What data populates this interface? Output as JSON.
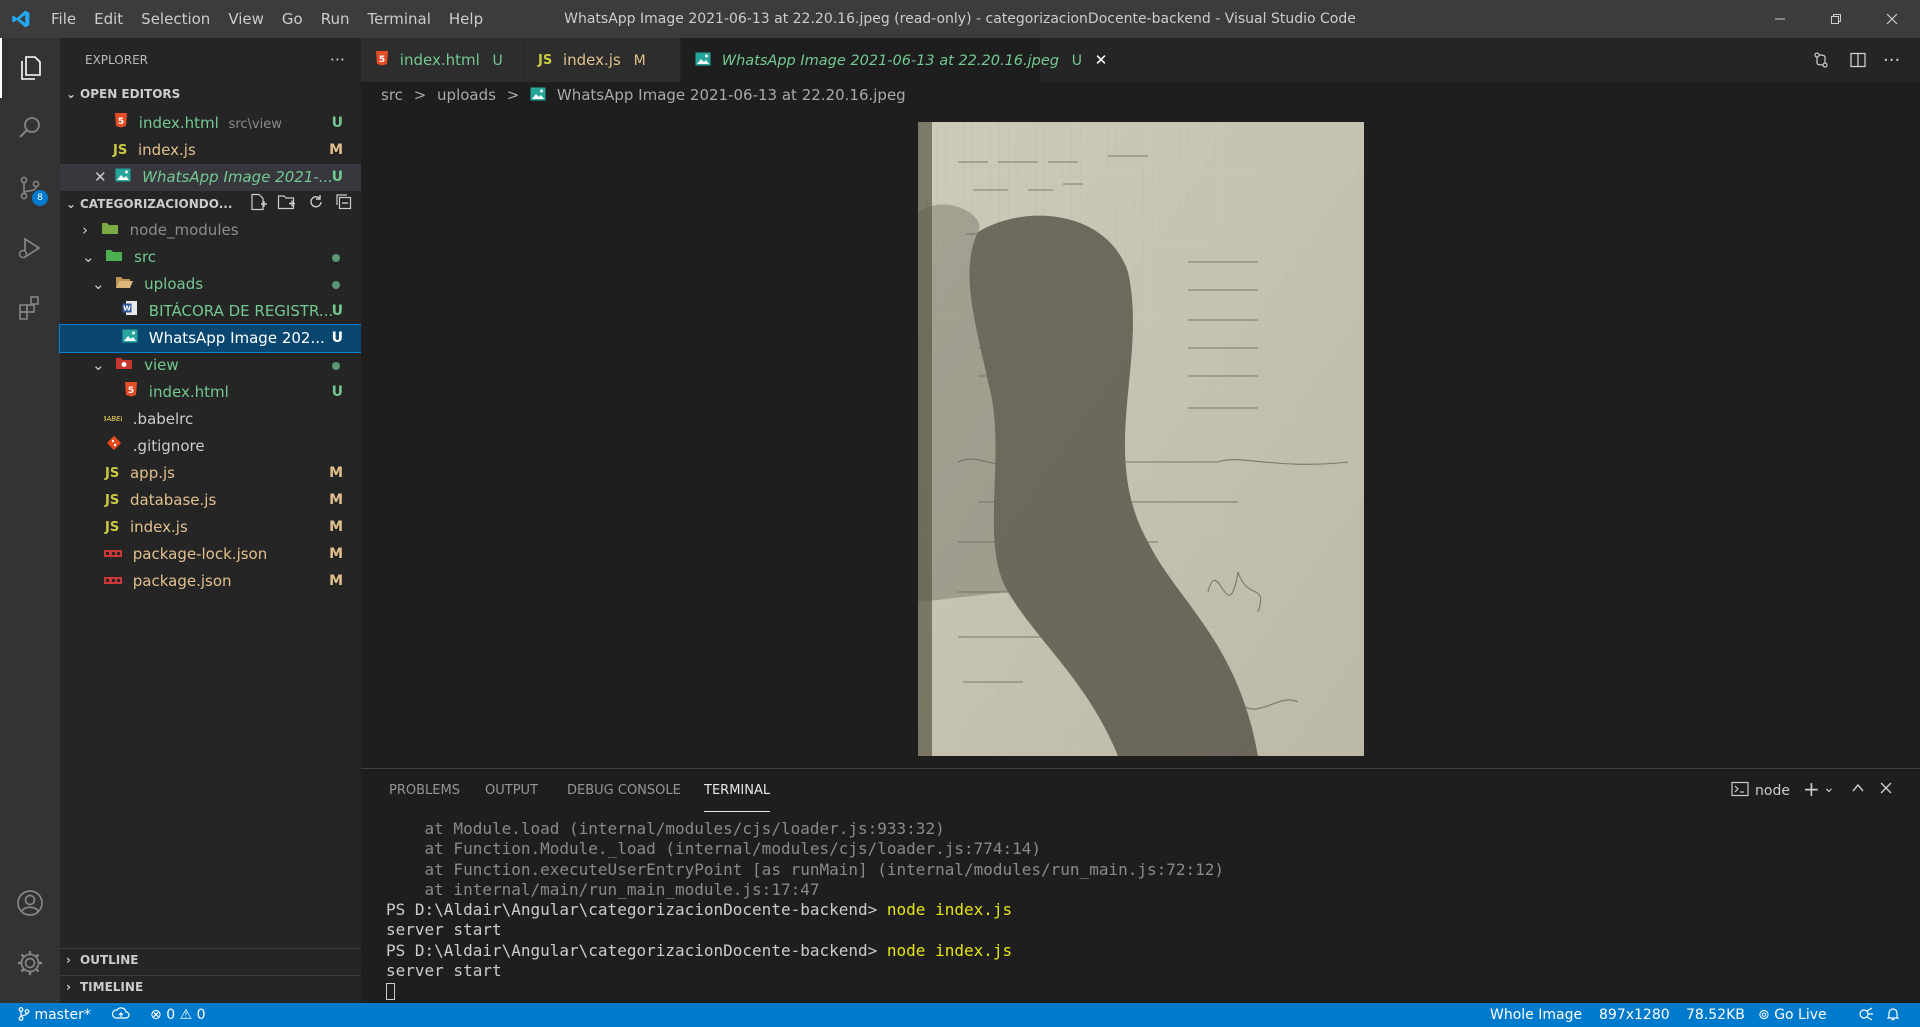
{
  "window": {
    "title": "WhatsApp Image 2021-06-13 at 22.20.16.jpeg (read-only) - categorizacionDocente-backend - Visual Studio Code",
    "menu": [
      "File",
      "Edit",
      "Selection",
      "View",
      "Go",
      "Run",
      "Terminal",
      "Help"
    ]
  },
  "activity_bar": {
    "scm_badge": "8"
  },
  "sidebar": {
    "title": "EXPLORER",
    "open_editors": {
      "header": "OPEN EDITORS",
      "items": [
        {
          "name": "index.html",
          "path": "src\\view",
          "status": "U"
        },
        {
          "name": "index.js",
          "status": "M"
        },
        {
          "name": "WhatsApp Image 2021-...",
          "status": "U"
        }
      ]
    },
    "project": {
      "header": "CATEGORIZACIONDO...",
      "tree": [
        {
          "label": "node_modules"
        },
        {
          "label": "src"
        },
        {
          "label": "uploads"
        },
        {
          "label": "BITÁCORA DE REGISTR...",
          "status": "U"
        },
        {
          "label": "WhatsApp Image 202...",
          "status": "U"
        },
        {
          "label": "view"
        },
        {
          "label": "index.html",
          "status": "U"
        },
        {
          "label": ".babelrc"
        },
        {
          "label": ".gitignore"
        },
        {
          "label": "app.js",
          "status": "M"
        },
        {
          "label": "database.js",
          "status": "M"
        },
        {
          "label": "index.js",
          "status": "M"
        },
        {
          "label": "package-lock.json",
          "status": "M"
        },
        {
          "label": "package.json",
          "status": "M"
        }
      ]
    },
    "outline": "OUTLINE",
    "timeline": "TIMELINE"
  },
  "tabs": [
    {
      "label": "index.html",
      "status": "U"
    },
    {
      "label": "index.js",
      "status": "M"
    },
    {
      "label": "WhatsApp Image 2021-06-13 at 22.20.16.jpeg",
      "status": "U"
    }
  ],
  "breadcrumb": [
    "src",
    "uploads",
    "WhatsApp Image 2021-06-13 at 22.20.16.jpeg"
  ],
  "panel": {
    "tabs": [
      "PROBLEMS",
      "OUTPUT",
      "DEBUG CONSOLE",
      "TERMINAL"
    ],
    "terminal_name": "node",
    "lines": [
      "    at Module.load (internal/modules/cjs/loader.js:933:32)",
      "    at Function.Module._load (internal/modules/cjs/loader.js:774:14)",
      "    at Function.executeUserEntryPoint [as runMain] (internal/modules/run_main.js:72:12)",
      "    at internal/main/run_main_module.js:17:47"
    ],
    "prompt": "PS D:\\Aldair\\Angular\\categorizacionDocente-backend> ",
    "command": "node index.js",
    "output": "server start"
  },
  "status_bar": {
    "branch": "master*",
    "errors": "0",
    "warnings": "0",
    "image_mode": "Whole Image",
    "dimensions": "897x1280",
    "size": "78.52KB",
    "go_live": "Go Live"
  },
  "colors": {
    "accent": "#007acc",
    "untracked": "#73c991",
    "modified": "#e2c08d"
  }
}
